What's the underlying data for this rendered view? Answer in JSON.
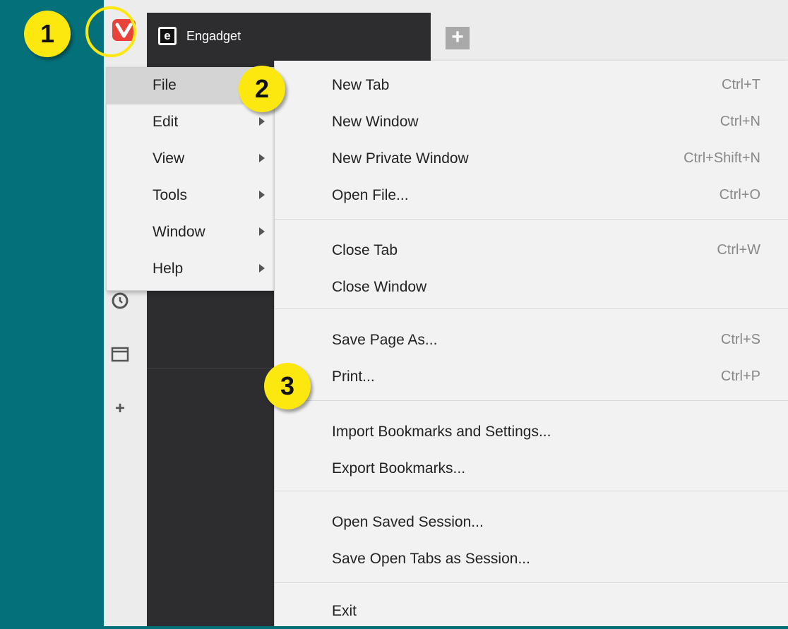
{
  "callouts": [
    "1",
    "2",
    "3"
  ],
  "tab": {
    "favicon_letter": "e",
    "title": "Engadget"
  },
  "new_tab_symbol": "+",
  "panel": {
    "add_symbol": "+",
    "icons": [
      "history-icon",
      "window-icon",
      "plus-icon"
    ]
  },
  "main_menu": [
    {
      "label": "File",
      "has_submenu": true,
      "active": true
    },
    {
      "label": "Edit",
      "has_submenu": true
    },
    {
      "label": "View",
      "has_submenu": true
    },
    {
      "label": "Tools",
      "has_submenu": true
    },
    {
      "label": "Window",
      "has_submenu": true
    },
    {
      "label": "Help",
      "has_submenu": true
    }
  ],
  "file_menu": [
    {
      "label": "New Tab",
      "shortcut": "Ctrl+T"
    },
    {
      "label": "New Window",
      "shortcut": "Ctrl+N"
    },
    {
      "label": "New Private Window",
      "shortcut": "Ctrl+Shift+N"
    },
    {
      "label": "Open File...",
      "shortcut": "Ctrl+O"
    },
    {
      "label": "Close Tab",
      "shortcut": "Ctrl+W"
    },
    {
      "label": "Close Window",
      "shortcut": ""
    },
    {
      "label": "Save Page As...",
      "shortcut": "Ctrl+S"
    },
    {
      "label": "Print...",
      "shortcut": "Ctrl+P"
    },
    {
      "label": "Import Bookmarks and Settings...",
      "shortcut": ""
    },
    {
      "label": "Export Bookmarks...",
      "shortcut": ""
    },
    {
      "label": "Open Saved Session...",
      "shortcut": ""
    },
    {
      "label": "Save Open Tabs as Session...",
      "shortcut": ""
    },
    {
      "label": "Exit",
      "shortcut": ""
    }
  ],
  "colors": {
    "background": "#04707a",
    "callout": "#fce80f",
    "vivaldi_red": "#e8423a",
    "tab_dark": "#2d2d30"
  }
}
